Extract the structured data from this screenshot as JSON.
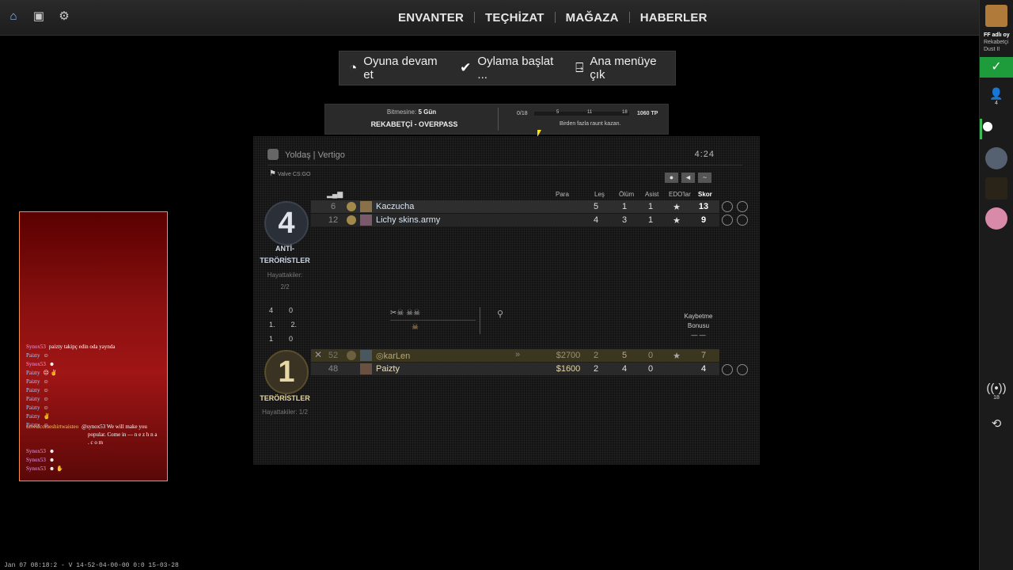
{
  "topbar": {
    "icons": [
      "home-icon",
      "inventory-icon",
      "gear-icon"
    ],
    "nav": [
      "ENVANTER",
      "TEÇHİZAT",
      "MAĞAZA",
      "HABERLER"
    ]
  },
  "pause_menu": {
    "resume": "Oyuna devam et",
    "vote": "Oylama başlat ...",
    "exit": "Ana menüye çık"
  },
  "pass": {
    "remaining_label": "Bitmesine:",
    "remaining_value": "5 Gün",
    "mode": "REKABETÇİ - OVERPASS",
    "progress": "0/18",
    "marks": [
      "5",
      "11",
      "18"
    ],
    "tp": "1060 TP",
    "mission": "Birden fazla raunt kazan."
  },
  "scoreboard": {
    "title": "Yoldaş | Vertigo",
    "server": "Valve CS:GO",
    "time": "4:24",
    "headers": {
      "money": "Para",
      "kills": "Leş",
      "deaths": "Ölüm",
      "assists": "Asist",
      "mvp": "EDO'lar",
      "score": "Skor"
    },
    "ct": {
      "score": "4",
      "name_line1": "ANTİ-",
      "name_line2": "TERÖRİSTLER",
      "alive_label": "Hayattakiler:",
      "alive": "2/2",
      "players": [
        {
          "ping": "6",
          "name": "Kaczucha",
          "kills": "5",
          "deaths": "1",
          "assists": "1",
          "score": "13"
        },
        {
          "ping": "12",
          "name": "Lichy skins.army",
          "kills": "4",
          "deaths": "3",
          "assists": "1",
          "score": "9"
        }
      ]
    },
    "history": {
      "rows": [
        [
          "4",
          "0"
        ],
        [
          "1.",
          "2."
        ],
        [
          "1",
          "0"
        ]
      ],
      "loss_bonus_line1": "Kaybetme",
      "loss_bonus_line2": "Bonusu",
      "loss_bonus_value": "— —"
    },
    "t": {
      "score": "1",
      "name": "TERÖRİSTLER",
      "alive": "Hayattakiler: 1/2",
      "players": [
        {
          "ping": "52",
          "name": "karLen",
          "money": "$2700",
          "kills": "2",
          "deaths": "5",
          "assists": "0",
          "score": "7"
        },
        {
          "ping": "48",
          "name": "Paizty",
          "money": "$1600",
          "kills": "2",
          "deaths": "4",
          "assists": "0",
          "score": "4"
        }
      ]
    }
  },
  "friends": {
    "notice_name": "FF adlı oy",
    "notice_line2": "Rekabetçi",
    "notice_line3": "Dust II",
    "count": "4",
    "live_count": "18"
  },
  "chat": [
    {
      "name": "Synox53",
      "text": "paizty takipç edin oda yaynda"
    },
    {
      "name": "Paizty",
      "text": "☺"
    },
    {
      "name": "Synox53",
      "text": "☻"
    },
    {
      "name": "Paizty",
      "text": "☹ ✌"
    },
    {
      "name": "Paizty",
      "text": "☺"
    },
    {
      "name": "Paizty",
      "text": "☺"
    },
    {
      "name": "Paizty",
      "text": "☺"
    },
    {
      "name": "Paizty",
      "text": "☺"
    },
    {
      "name": "Paizty",
      "text": "✌"
    },
    {
      "name": "Paizty",
      "text": "☺"
    },
    {
      "name": "unwelcomeshirtwaisteo",
      "text": "@synox53 We will make you"
    },
    {
      "name": "",
      "text": "popular. Come in — n e z h n a"
    },
    {
      "name": "",
      "text": ". c o m"
    },
    {
      "name": "Synox53",
      "text": "☻"
    },
    {
      "name": "Synox53",
      "text": "☻"
    },
    {
      "name": "Synox53",
      "text": "☻ ✋"
    }
  ],
  "bottom_text": "Jan 07 08:18:2 - V 14-52-04-00-00 0:0 15-03-28"
}
